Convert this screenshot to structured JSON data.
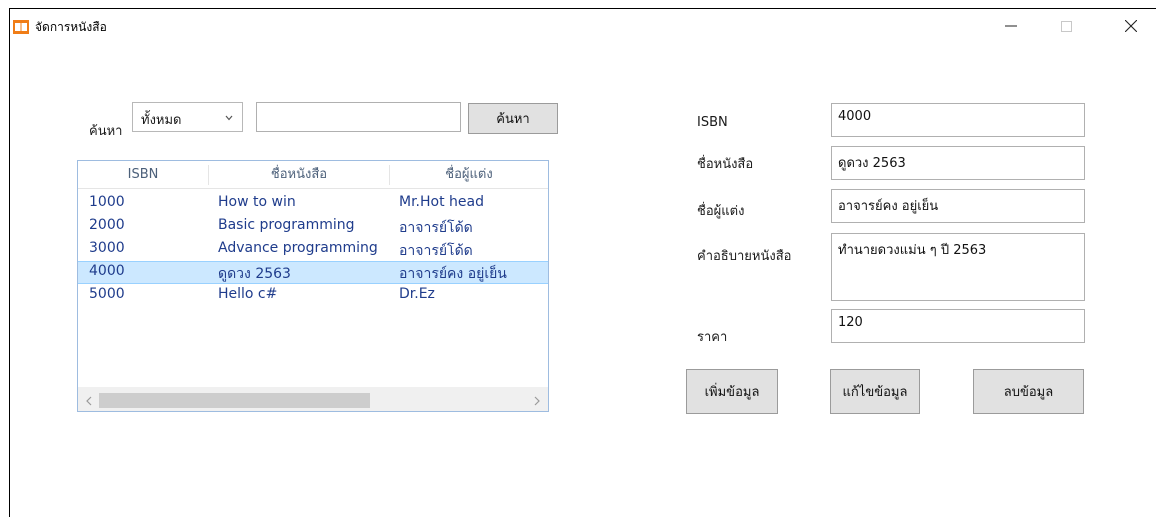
{
  "window": {
    "title": "จัดการหนังสือ"
  },
  "search": {
    "label": "ค้นหา",
    "filter_selected": "ทั้งหมด",
    "query_value": "",
    "button_label": "ค้นหา"
  },
  "table": {
    "columns": [
      "ISBN",
      "ชื่อหนังสือ",
      "ชื่อผู้แต่ง"
    ],
    "rows": [
      {
        "isbn": "1000",
        "title": "How to win",
        "author": "Mr.Hot head"
      },
      {
        "isbn": "2000",
        "title": "Basic programming",
        "author": "อาจารย์โด้ด"
      },
      {
        "isbn": "3000",
        "title": "Advance programming",
        "author": "อาจารย์โด้ด"
      },
      {
        "isbn": "4000",
        "title": "ดูดวง 2563",
        "author": "อาจารย์คง อยู่เย็น"
      },
      {
        "isbn": "5000",
        "title": "Hello c#",
        "author": "Dr.Ez"
      }
    ],
    "selected_row": 3
  },
  "form": {
    "isbn_label": "ISBN",
    "isbn_value": "4000",
    "title_label": "ชื่อหนังสือ",
    "title_value": "ดูดวง 2563",
    "author_label": "ชื่อผู้แต่ง",
    "author_value": "อาจารย์คง อยู่เย็น",
    "description_label": "คำอธิบายหนังสือ",
    "description_value": "ทำนายดวงแม่น ๆ ปี 2563",
    "price_label": "ราคา",
    "price_value": "120"
  },
  "actions": {
    "add_label": "เพิ่มข้อมูล",
    "edit_label": "แก้ไขข้อมูล",
    "delete_label": "ลบข้อมูล"
  },
  "colors": {
    "accent": "#cce8ff",
    "app_icon": "#f07d17",
    "row_text": "#1f3c8c"
  },
  "icons": {
    "app": "book-icon",
    "minimize": "minimize-icon",
    "maximize": "maximize-icon",
    "close": "close-icon",
    "dropdown": "chevron-down-icon",
    "scroll_left": "chevron-left-icon",
    "scroll_right": "chevron-right-icon"
  }
}
